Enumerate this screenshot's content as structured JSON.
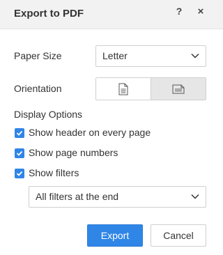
{
  "dialog": {
    "title": "Export to PDF",
    "help_icon": "?",
    "close_icon": "×"
  },
  "paper_size": {
    "label": "Paper Size",
    "selected": "Letter",
    "icon": "chevron-down-icon"
  },
  "orientation": {
    "label": "Orientation",
    "options": [
      {
        "icon": "portrait-page-icon",
        "selected": false
      },
      {
        "icon": "landscape-page-icon",
        "selected": true
      }
    ]
  },
  "display_options": {
    "label": "Display Options",
    "checkboxes": [
      {
        "label": "Show header on every page",
        "checked": true
      },
      {
        "label": "Show page numbers",
        "checked": true
      },
      {
        "label": "Show filters",
        "checked": true
      }
    ]
  },
  "filters_placement": {
    "selected": "All filters at the end",
    "icon": "chevron-down-icon"
  },
  "buttons": {
    "export": "Export",
    "cancel": "Cancel"
  },
  "colors": {
    "accent": "#2f86e6",
    "header_bg": "#f2f2f2",
    "selected_segment": "#e6e6e6"
  }
}
